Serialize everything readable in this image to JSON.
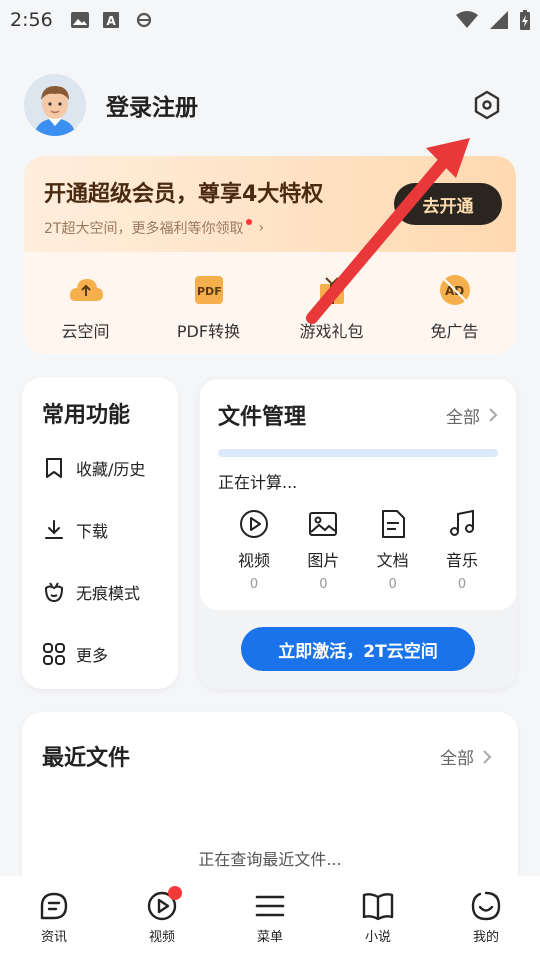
{
  "status_bar": {
    "time": "2:56",
    "icons": [
      "image-icon",
      "text-icon",
      "browser-icon",
      "wifi-icon",
      "signal-icon",
      "battery-charging-icon"
    ]
  },
  "profile": {
    "login_label": "登录注册",
    "settings_icon": "settings-hexagon-icon"
  },
  "vip": {
    "title": "开通超级会员，尊享4大特权",
    "subtitle": "2T超大空间，更多福利等你领取",
    "button": "去开通",
    "items": [
      {
        "label": "云空间",
        "icon": "cloud-upload-icon"
      },
      {
        "label": "PDF转换",
        "icon": "pdf-icon"
      },
      {
        "label": "游戏礼包",
        "icon": "gift-icon"
      },
      {
        "label": "免广告",
        "icon": "ad-free-icon"
      }
    ]
  },
  "common": {
    "title": "常用功能",
    "items": [
      {
        "label": "收藏/历史",
        "icon": "bookmark-icon"
      },
      {
        "label": "下载",
        "icon": "download-icon"
      },
      {
        "label": "无痕模式",
        "icon": "incognito-icon"
      },
      {
        "label": "更多",
        "icon": "grid-more-icon"
      }
    ]
  },
  "files": {
    "title": "文件管理",
    "all_label": "全部",
    "calculating": "正在计算...",
    "types": [
      {
        "label": "视频",
        "count": "0",
        "icon": "video-play-icon"
      },
      {
        "label": "图片",
        "count": "0",
        "icon": "image-icon"
      },
      {
        "label": "文档",
        "count": "0",
        "icon": "document-icon"
      },
      {
        "label": "音乐",
        "count": "0",
        "icon": "music-icon"
      }
    ],
    "activate_button": "立即激活，2T云空间"
  },
  "recent": {
    "title": "最近文件",
    "all_label": "全部",
    "empty_text": "正在查询最近文件..."
  },
  "bottom_nav": [
    {
      "label": "资讯",
      "icon": "news-icon"
    },
    {
      "label": "视频",
      "icon": "video-icon",
      "badge": true
    },
    {
      "label": "菜单",
      "icon": "menu-icon"
    },
    {
      "label": "小说",
      "icon": "book-icon"
    },
    {
      "label": "我的",
      "icon": "profile-smile-icon"
    }
  ],
  "colors": {
    "accent": "#1a73e8",
    "vip_dark": "#2b2520",
    "vip_gold": "#ffdcb0",
    "badge_red": "#f43a3a",
    "annotation_arrow": "#e8383a"
  }
}
